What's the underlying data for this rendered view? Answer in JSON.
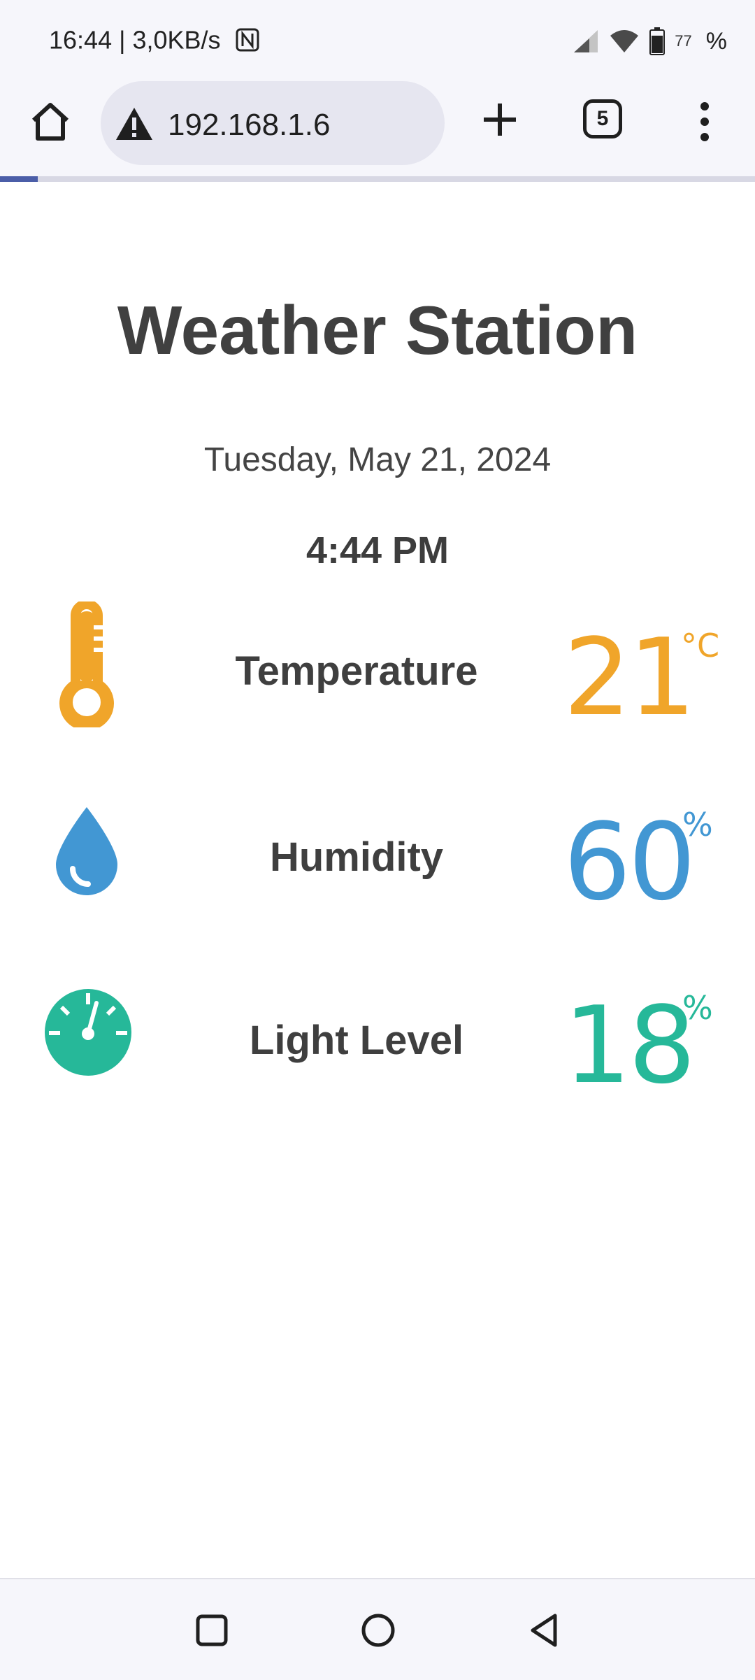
{
  "statusbar": {
    "time": "16:44",
    "speed": "3,0KB/s",
    "separator": "|",
    "battery_level": "77",
    "battery_symbol": "%"
  },
  "browser": {
    "url": "192.168.1.6",
    "tab_count": "5",
    "load_progress_fraction": 0.05
  },
  "page": {
    "title": "Weather Station",
    "date": "Tuesday, May 21, 2024",
    "time": "4:44 PM",
    "readings": [
      {
        "label": "Temperature",
        "value": "21",
        "unit": "°C",
        "color": "#f0a52a",
        "icon": "thermometer-icon"
      },
      {
        "label": "Humidity",
        "value": "60",
        "unit": "%",
        "color": "#4297d3",
        "icon": "water-drop-icon"
      },
      {
        "label": "Light Level",
        "value": "18",
        "unit": "%",
        "color": "#26b899",
        "icon": "gauge-icon"
      }
    ]
  }
}
